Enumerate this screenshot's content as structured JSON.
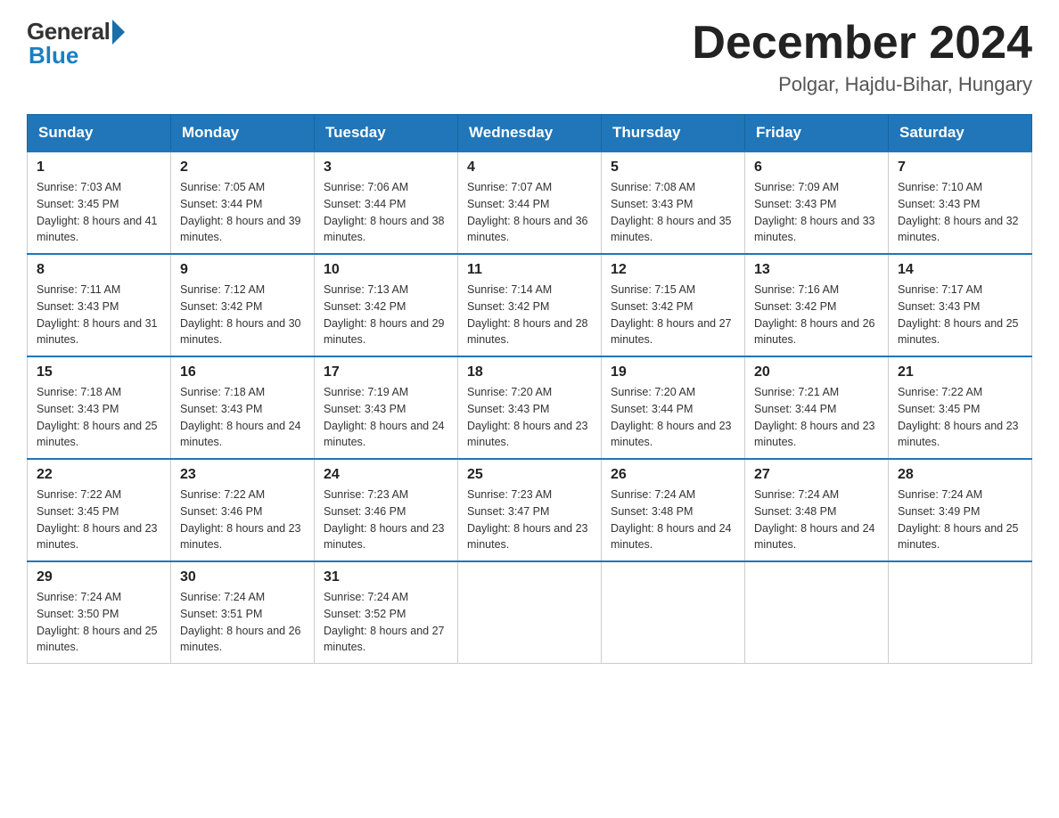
{
  "header": {
    "logo_general": "General",
    "logo_blue": "Blue",
    "title": "December 2024",
    "subtitle": "Polgar, Hajdu-Bihar, Hungary"
  },
  "columns": [
    "Sunday",
    "Monday",
    "Tuesday",
    "Wednesday",
    "Thursday",
    "Friday",
    "Saturday"
  ],
  "weeks": [
    [
      {
        "day": "1",
        "sunrise": "Sunrise: 7:03 AM",
        "sunset": "Sunset: 3:45 PM",
        "daylight": "Daylight: 8 hours and 41 minutes."
      },
      {
        "day": "2",
        "sunrise": "Sunrise: 7:05 AM",
        "sunset": "Sunset: 3:44 PM",
        "daylight": "Daylight: 8 hours and 39 minutes."
      },
      {
        "day": "3",
        "sunrise": "Sunrise: 7:06 AM",
        "sunset": "Sunset: 3:44 PM",
        "daylight": "Daylight: 8 hours and 38 minutes."
      },
      {
        "day": "4",
        "sunrise": "Sunrise: 7:07 AM",
        "sunset": "Sunset: 3:44 PM",
        "daylight": "Daylight: 8 hours and 36 minutes."
      },
      {
        "day": "5",
        "sunrise": "Sunrise: 7:08 AM",
        "sunset": "Sunset: 3:43 PM",
        "daylight": "Daylight: 8 hours and 35 minutes."
      },
      {
        "day": "6",
        "sunrise": "Sunrise: 7:09 AM",
        "sunset": "Sunset: 3:43 PM",
        "daylight": "Daylight: 8 hours and 33 minutes."
      },
      {
        "day": "7",
        "sunrise": "Sunrise: 7:10 AM",
        "sunset": "Sunset: 3:43 PM",
        "daylight": "Daylight: 8 hours and 32 minutes."
      }
    ],
    [
      {
        "day": "8",
        "sunrise": "Sunrise: 7:11 AM",
        "sunset": "Sunset: 3:43 PM",
        "daylight": "Daylight: 8 hours and 31 minutes."
      },
      {
        "day": "9",
        "sunrise": "Sunrise: 7:12 AM",
        "sunset": "Sunset: 3:42 PM",
        "daylight": "Daylight: 8 hours and 30 minutes."
      },
      {
        "day": "10",
        "sunrise": "Sunrise: 7:13 AM",
        "sunset": "Sunset: 3:42 PM",
        "daylight": "Daylight: 8 hours and 29 minutes."
      },
      {
        "day": "11",
        "sunrise": "Sunrise: 7:14 AM",
        "sunset": "Sunset: 3:42 PM",
        "daylight": "Daylight: 8 hours and 28 minutes."
      },
      {
        "day": "12",
        "sunrise": "Sunrise: 7:15 AM",
        "sunset": "Sunset: 3:42 PM",
        "daylight": "Daylight: 8 hours and 27 minutes."
      },
      {
        "day": "13",
        "sunrise": "Sunrise: 7:16 AM",
        "sunset": "Sunset: 3:42 PM",
        "daylight": "Daylight: 8 hours and 26 minutes."
      },
      {
        "day": "14",
        "sunrise": "Sunrise: 7:17 AM",
        "sunset": "Sunset: 3:43 PM",
        "daylight": "Daylight: 8 hours and 25 minutes."
      }
    ],
    [
      {
        "day": "15",
        "sunrise": "Sunrise: 7:18 AM",
        "sunset": "Sunset: 3:43 PM",
        "daylight": "Daylight: 8 hours and 25 minutes."
      },
      {
        "day": "16",
        "sunrise": "Sunrise: 7:18 AM",
        "sunset": "Sunset: 3:43 PM",
        "daylight": "Daylight: 8 hours and 24 minutes."
      },
      {
        "day": "17",
        "sunrise": "Sunrise: 7:19 AM",
        "sunset": "Sunset: 3:43 PM",
        "daylight": "Daylight: 8 hours and 24 minutes."
      },
      {
        "day": "18",
        "sunrise": "Sunrise: 7:20 AM",
        "sunset": "Sunset: 3:43 PM",
        "daylight": "Daylight: 8 hours and 23 minutes."
      },
      {
        "day": "19",
        "sunrise": "Sunrise: 7:20 AM",
        "sunset": "Sunset: 3:44 PM",
        "daylight": "Daylight: 8 hours and 23 minutes."
      },
      {
        "day": "20",
        "sunrise": "Sunrise: 7:21 AM",
        "sunset": "Sunset: 3:44 PM",
        "daylight": "Daylight: 8 hours and 23 minutes."
      },
      {
        "day": "21",
        "sunrise": "Sunrise: 7:22 AM",
        "sunset": "Sunset: 3:45 PM",
        "daylight": "Daylight: 8 hours and 23 minutes."
      }
    ],
    [
      {
        "day": "22",
        "sunrise": "Sunrise: 7:22 AM",
        "sunset": "Sunset: 3:45 PM",
        "daylight": "Daylight: 8 hours and 23 minutes."
      },
      {
        "day": "23",
        "sunrise": "Sunrise: 7:22 AM",
        "sunset": "Sunset: 3:46 PM",
        "daylight": "Daylight: 8 hours and 23 minutes."
      },
      {
        "day": "24",
        "sunrise": "Sunrise: 7:23 AM",
        "sunset": "Sunset: 3:46 PM",
        "daylight": "Daylight: 8 hours and 23 minutes."
      },
      {
        "day": "25",
        "sunrise": "Sunrise: 7:23 AM",
        "sunset": "Sunset: 3:47 PM",
        "daylight": "Daylight: 8 hours and 23 minutes."
      },
      {
        "day": "26",
        "sunrise": "Sunrise: 7:24 AM",
        "sunset": "Sunset: 3:48 PM",
        "daylight": "Daylight: 8 hours and 24 minutes."
      },
      {
        "day": "27",
        "sunrise": "Sunrise: 7:24 AM",
        "sunset": "Sunset: 3:48 PM",
        "daylight": "Daylight: 8 hours and 24 minutes."
      },
      {
        "day": "28",
        "sunrise": "Sunrise: 7:24 AM",
        "sunset": "Sunset: 3:49 PM",
        "daylight": "Daylight: 8 hours and 25 minutes."
      }
    ],
    [
      {
        "day": "29",
        "sunrise": "Sunrise: 7:24 AM",
        "sunset": "Sunset: 3:50 PM",
        "daylight": "Daylight: 8 hours and 25 minutes."
      },
      {
        "day": "30",
        "sunrise": "Sunrise: 7:24 AM",
        "sunset": "Sunset: 3:51 PM",
        "daylight": "Daylight: 8 hours and 26 minutes."
      },
      {
        "day": "31",
        "sunrise": "Sunrise: 7:24 AM",
        "sunset": "Sunset: 3:52 PM",
        "daylight": "Daylight: 8 hours and 27 minutes."
      },
      null,
      null,
      null,
      null
    ]
  ]
}
